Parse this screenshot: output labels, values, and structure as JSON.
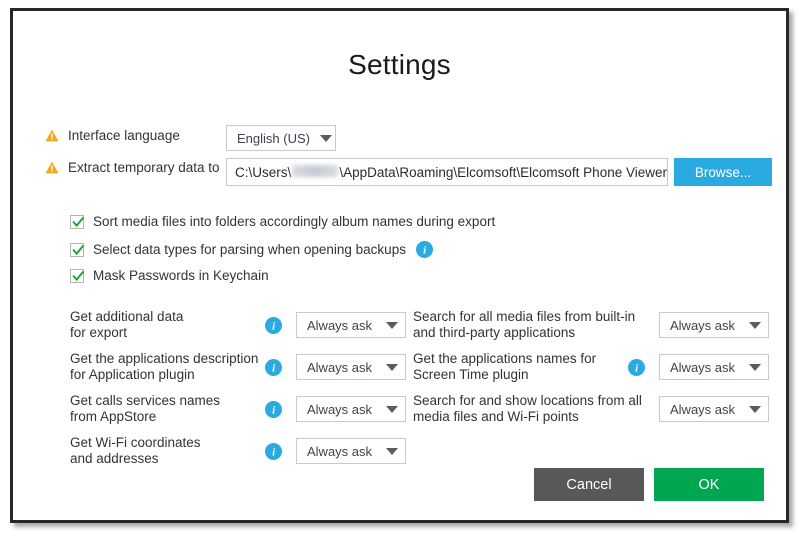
{
  "window": {
    "title": "Settings"
  },
  "fields": {
    "language": {
      "label": "Interface language",
      "warning_icon": "warning-triangle-icon",
      "value": "English (US)"
    },
    "extract_path": {
      "label": "Extract temporary data to",
      "warning_icon": "warning-triangle-icon",
      "value_prefix": "C:\\Users\\",
      "value_suffix": "\\AppData\\Roaming\\Elcomsoft\\Elcomsoft Phone Viewer",
      "browse_label": "Browse..."
    }
  },
  "checkboxes": [
    {
      "label": "Sort media files into folders accordingly album names during export",
      "checked": true,
      "has_info": false
    },
    {
      "label": "Select data types for parsing when opening backups",
      "checked": true,
      "has_info": true
    },
    {
      "label": "Mask Passwords in Keychain",
      "checked": true,
      "has_info": false
    }
  ],
  "options_left": [
    {
      "line1": "Get additional data",
      "line2": "for export",
      "has_info": true,
      "value": "Always ask"
    },
    {
      "line1": "Get the applications description",
      "line2": "for Application plugin",
      "has_info": true,
      "value": "Always ask"
    },
    {
      "line1": "Get calls services names",
      "line2": "from AppStore",
      "has_info": true,
      "value": "Always ask"
    },
    {
      "line1": "Get Wi-Fi coordinates",
      "line2": "and addresses",
      "has_info": true,
      "value": "Always ask"
    }
  ],
  "options_right": [
    {
      "line1": "Search for all media files from built-in",
      "line2": "and third-party applications",
      "has_info": false,
      "value": "Always ask"
    },
    {
      "line1": "Get the applications names for",
      "line2": "Screen Time plugin",
      "has_info": true,
      "value": "Always ask"
    },
    {
      "line1": "Search for and show locations from all",
      "line2": "media files and Wi-Fi points",
      "has_info": false,
      "value": "Always ask"
    }
  ],
  "buttons": {
    "cancel": "Cancel",
    "ok": "OK"
  },
  "colors": {
    "accent_blue": "#29abe2",
    "ok_green": "#00a650",
    "cancel_gray": "#585858",
    "warning_orange": "#f5a623",
    "check_green": "#22a33c"
  }
}
